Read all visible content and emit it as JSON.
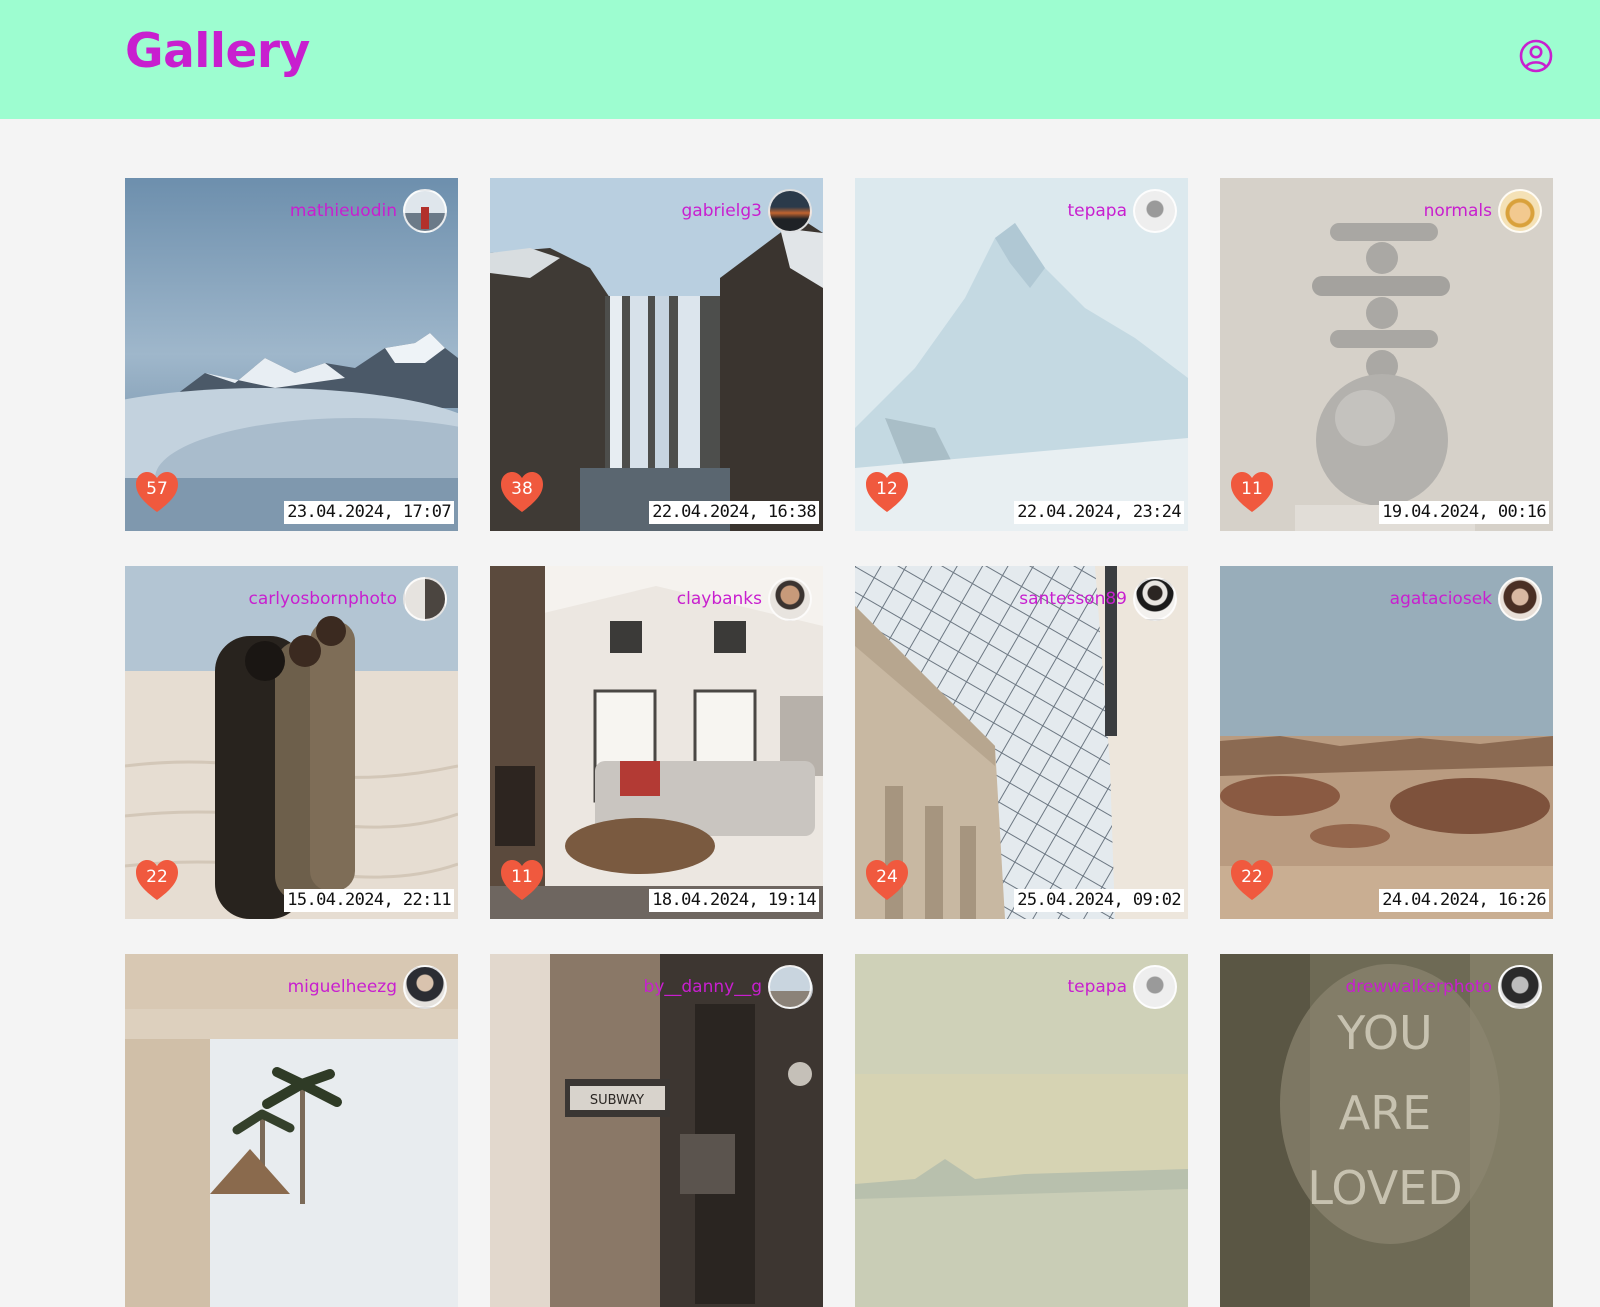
{
  "header": {
    "title": "Gallery",
    "profile_icon": "user-circle-icon",
    "brand_color": "#c81fcf",
    "bar_color": "#9dfdd0"
  },
  "like_color": "#f0593e",
  "gallery": {
    "cards": [
      {
        "author": "mathieuodin",
        "likes": "57",
        "date": "23.04.2024, 17:07",
        "subject": "snowy mountain peaks above clouds"
      },
      {
        "author": "gabrielg3",
        "likes": "38",
        "date": "22.04.2024, 16:38",
        "subject": "waterfall between dark cliffs"
      },
      {
        "author": "tepapa",
        "likes": "12",
        "date": "22.04.2024, 23:24",
        "subject": "pale snowy mountain painting"
      },
      {
        "author": "normals",
        "likes": "11",
        "date": "19.04.2024, 00:16",
        "subject": "balanced sculpture of spheres and cylinders"
      },
      {
        "author": "carlyosbornphoto",
        "likes": "22",
        "date": "15.04.2024, 22:11",
        "subject": "three women in suits on sand dunes"
      },
      {
        "author": "claybanks",
        "likes": "11",
        "date": "18.04.2024, 19:14",
        "subject": "living room with fireplace and sectional sofa"
      },
      {
        "author": "santesson89",
        "likes": "24",
        "date": "25.04.2024, 09:02",
        "subject": "museum glass roof and classical facade"
      },
      {
        "author": "agataciosek",
        "likes": "22",
        "date": "24.04.2024, 16:26",
        "subject": "rocky desert landscape"
      },
      {
        "author": "miguelheezg",
        "likes": "",
        "date": "",
        "subject": "palm trees framed by white wall"
      },
      {
        "author": "by__danny__g",
        "likes": "",
        "date": "",
        "subject": "street with subway sign"
      },
      {
        "author": "tepapa",
        "likes": "",
        "date": "",
        "subject": "pale coastal landscape painting"
      },
      {
        "author": "drewwalkerphoto",
        "likes": "",
        "date": "",
        "subject": "concrete wall with chalk writing YOU ARE LOVED"
      }
    ]
  }
}
